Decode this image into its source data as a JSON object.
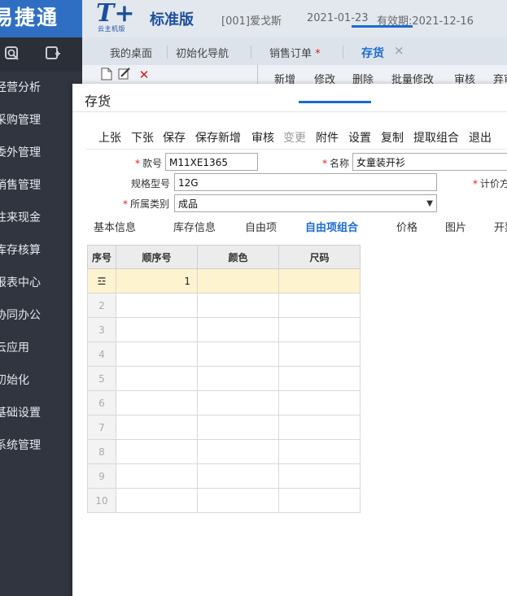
{
  "brand": {
    "title": "易捷通"
  },
  "product": {
    "mark": "T+",
    "sub": "云主机版",
    "edition": "标准版"
  },
  "header": {
    "company": "[001]爱戈斯",
    "date": "2021-01-23",
    "expiry": "有效期:2021-12-16"
  },
  "sidebar": {
    "items": [
      "经营分析",
      "采购管理",
      "委外管理",
      "销售管理",
      "往来现金",
      "库存核算",
      "报表中心",
      "协同办公",
      "云应用",
      "初始化",
      "基础设置",
      "系统管理"
    ]
  },
  "tabs": [
    {
      "label": "我的桌面"
    },
    {
      "label": "初始化导航"
    },
    {
      "label": "销售订单"
    },
    {
      "label": "存货"
    }
  ],
  "tab_modified_mark": "*",
  "tab_close": "×",
  "behind_toolbar": [
    "新增",
    "修改",
    "删除",
    "批量修改",
    "审核",
    "弃审"
  ],
  "dialog": {
    "title": "存货",
    "toolbar": [
      "上张",
      "下张",
      "保存",
      "保存新增",
      "审核",
      "变更",
      "附件",
      "设置",
      "复制",
      "提取组合",
      "退出"
    ],
    "form": {
      "code_label": "款号",
      "code_value": "M11XE1365",
      "name_label": "名称",
      "name_value": "女童装开衫",
      "spec_label": "规格型号",
      "spec_value": "12G",
      "category_label": "所属类别",
      "category_value": "成品",
      "pricing_label": "计价方式"
    },
    "subtabs": [
      "基本信息",
      "库存信息",
      "自由项",
      "自由项组合",
      "价格",
      "图片",
      "开票"
    ],
    "grid": {
      "headers": [
        "序号",
        "顺序号",
        "颜色",
        "尺码"
      ],
      "selected_row_icon": "☲",
      "first_row_order": "1",
      "row_numbers": [
        "2",
        "3",
        "4",
        "5",
        "6",
        "7",
        "8",
        "9",
        "10"
      ]
    }
  }
}
